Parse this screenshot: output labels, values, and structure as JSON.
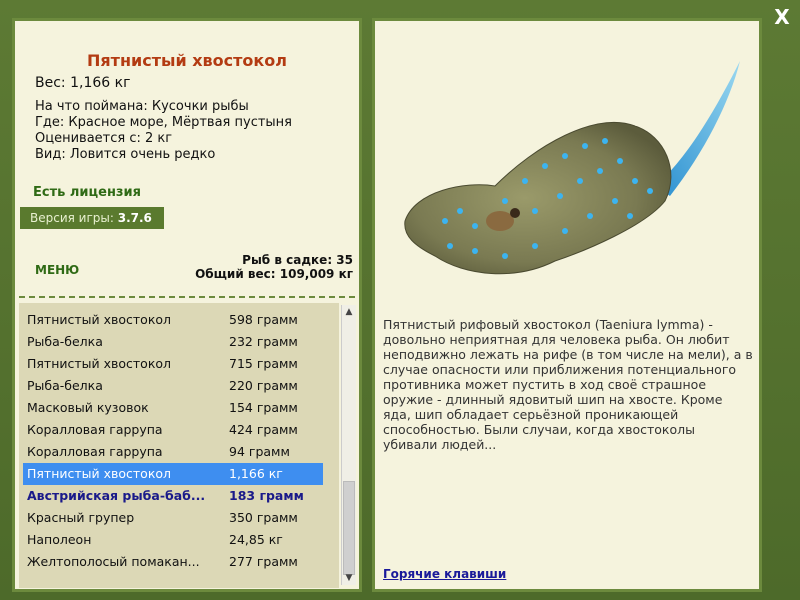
{
  "close_label": "X",
  "fish": {
    "title": "Пятнистый хвостокол",
    "weight": "Вес: 1,166 кг",
    "caught_with": "На что поймана: Кусочки рыбы",
    "location": "Где: Красное море, Мёртвая пустыня",
    "valued_from": "Оценивается с: 2 кг",
    "rarity": "Вид: Ловится очень редко",
    "description": "Пятнистый рифовый хвостокол (Taeniura lymma) - довольно неприятная для человека рыба. Он любит неподвижно лежать на рифе (в том числе на мели), а в случае опасности или приближения потенциального противника может пустить в ход своё страшное оружие - длинный ядовитый шип на хвосте. Кроме яда, шип обладает серьёзной проникающей способностью. Были случаи, когда хвостоколы убивали людей..."
  },
  "license": "Есть лицензия",
  "version": {
    "label": "Версия игры:",
    "value": "3.7.6"
  },
  "menu_label": "МЕНЮ",
  "stats": {
    "fish_count": "Рыб в садке: 35",
    "total_weight": "Общий вес: 109,009 кг"
  },
  "catch_list": [
    {
      "name": "Пятнистый хвостокол",
      "weight": "598 грамм"
    },
    {
      "name": "Рыба-белка",
      "weight": "232 грамм"
    },
    {
      "name": "Пятнистый хвостокол",
      "weight": "715 грамм"
    },
    {
      "name": "Рыба-белка",
      "weight": "220 грамм"
    },
    {
      "name": "Масковый кузовок",
      "weight": "154 грамм"
    },
    {
      "name": "Коралловая гаррупа",
      "weight": "424 грамм"
    },
    {
      "name": "Коралловая гаррупа",
      "weight": "94 грамм"
    },
    {
      "name": "Пятнистый хвостокол",
      "weight": "1,166 кг"
    },
    {
      "name": "Австрийская рыба-баб...",
      "weight": "183 грамм"
    },
    {
      "name": "Красный групер",
      "weight": "350 грамм"
    },
    {
      "name": "Наполеон",
      "weight": "24,85 кг"
    },
    {
      "name": "Желтополосый помакан...",
      "weight": "277 грамм"
    }
  ],
  "hotkeys_label": "Горячие клавиши",
  "colors": {
    "frame": "#5d7a34",
    "panel": "#f5f3dd",
    "title": "#b33b12",
    "selected": "#3e8ef0",
    "accent_green": "#2f6a15"
  }
}
